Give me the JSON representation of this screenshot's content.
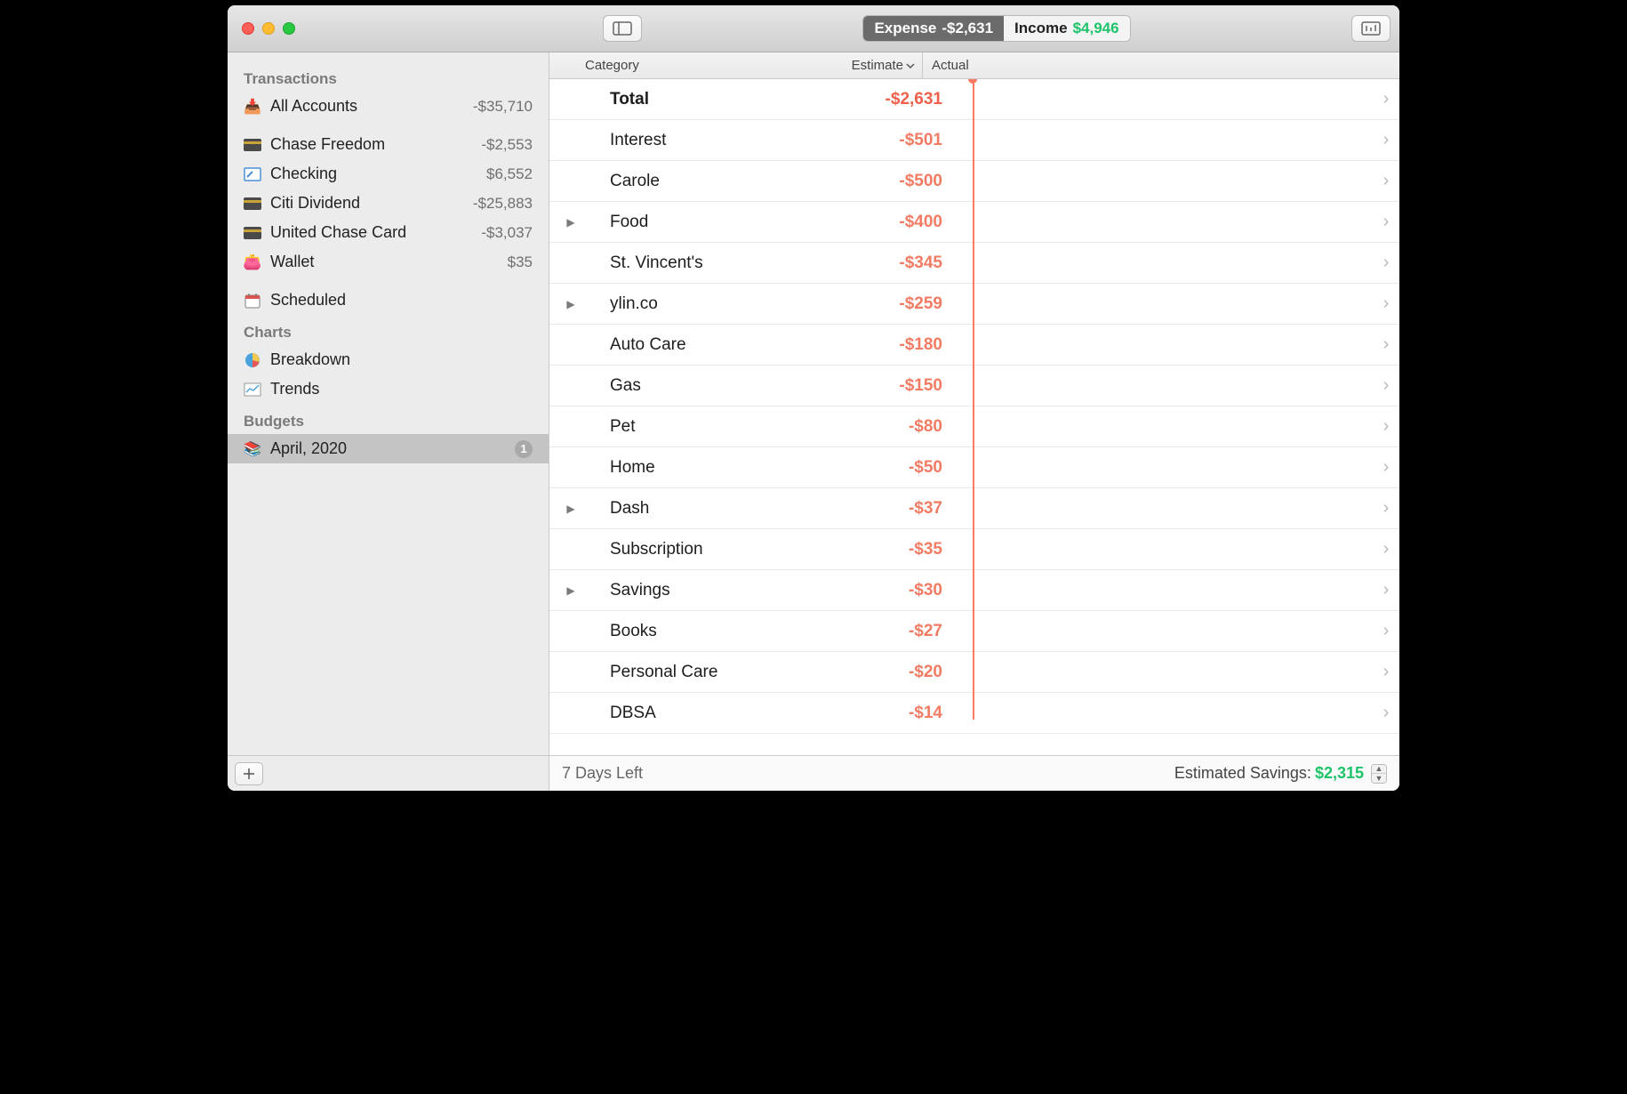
{
  "toolbar": {
    "expense_label": "Expense",
    "expense_value": "-$2,631",
    "income_label": "Income",
    "income_value": "$4,946"
  },
  "sidebar": {
    "groups": [
      {
        "title": "Transactions",
        "items": [
          {
            "icon": "📥",
            "name": "All Accounts",
            "amount": "-$35,710"
          }
        ]
      },
      {
        "title": "",
        "items": [
          {
            "icon": "card",
            "name": "Chase Freedom",
            "amount": "-$2,553"
          },
          {
            "icon": "check",
            "name": "Checking",
            "amount": "$6,552"
          },
          {
            "icon": "card",
            "name": "Citi Dividend",
            "amount": "-$25,883"
          },
          {
            "icon": "card",
            "name": "United Chase Card",
            "amount": "-$3,037"
          },
          {
            "icon": "wallet",
            "name": "Wallet",
            "amount": "$35"
          }
        ]
      },
      {
        "title": "",
        "items": [
          {
            "icon": "calendar",
            "name": "Scheduled",
            "amount": ""
          }
        ]
      },
      {
        "title": "Charts",
        "items": [
          {
            "icon": "pie",
            "name": "Breakdown",
            "amount": ""
          },
          {
            "icon": "chart",
            "name": "Trends",
            "amount": ""
          }
        ]
      },
      {
        "title": "Budgets",
        "items": [
          {
            "icon": "books",
            "name": "April, 2020",
            "badge": "1",
            "selected": true
          }
        ]
      }
    ]
  },
  "headers": {
    "category": "Category",
    "estimate": "Estimate",
    "actual": "Actual"
  },
  "marker_pct": 78,
  "rows": [
    {
      "expand": false,
      "total": true,
      "category": "Total",
      "estimate": "-$2,631",
      "bar_pct": 80
    },
    {
      "expand": false,
      "total": false,
      "category": "Interest",
      "estimate": "-$501",
      "bar_pct": 99
    },
    {
      "expand": false,
      "total": false,
      "category": "Carole",
      "estimate": "-$500",
      "bar_pct": 97
    },
    {
      "expand": true,
      "total": false,
      "category": "Food",
      "estimate": "-$400",
      "bar_pct": 90
    },
    {
      "expand": false,
      "total": false,
      "category": "St. Vincent's",
      "estimate": "-$345",
      "bar_pct": 90
    },
    {
      "expand": true,
      "total": false,
      "category": "ylin.co",
      "estimate": "-$259",
      "bar_pct": 48
    },
    {
      "expand": false,
      "total": false,
      "category": "Auto Care",
      "estimate": "-$180",
      "bar_pct": 0
    },
    {
      "expand": false,
      "total": false,
      "category": "Gas",
      "estimate": "-$150",
      "bar_pct": 67
    },
    {
      "expand": false,
      "total": false,
      "category": "Pet",
      "estimate": "-$80",
      "bar_pct": 90
    },
    {
      "expand": false,
      "total": false,
      "category": "Home",
      "estimate": "-$50",
      "bar_pct": 76
    },
    {
      "expand": true,
      "total": false,
      "category": "Dash",
      "estimate": "-$37",
      "bar_pct": 95
    },
    {
      "expand": false,
      "total": false,
      "category": "Subscription",
      "estimate": "-$35",
      "bar_pct": 90
    },
    {
      "expand": true,
      "total": false,
      "category": "Savings",
      "estimate": "-$30",
      "bar_pct": 87
    },
    {
      "expand": false,
      "total": false,
      "category": "Books",
      "estimate": "-$27",
      "bar_pct": 100
    },
    {
      "expand": false,
      "total": false,
      "category": "Personal Care",
      "estimate": "-$20",
      "bar_pct": 0
    },
    {
      "expand": false,
      "total": false,
      "category": "DBSA",
      "estimate": "-$14",
      "bar_pct": 97
    }
  ],
  "status": {
    "days_left": "7 Days Left",
    "est_savings_label": "Estimated Savings:",
    "est_savings_value": "$2,315"
  }
}
